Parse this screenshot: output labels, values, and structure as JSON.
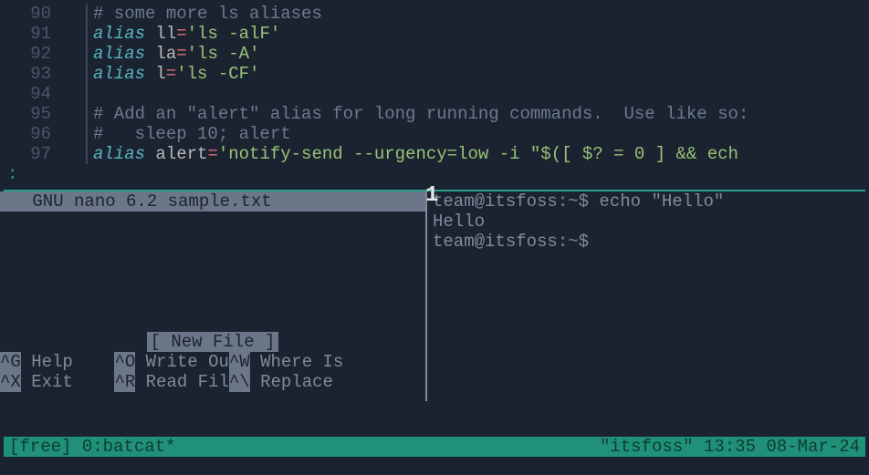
{
  "code": {
    "lines": [
      {
        "n": "90",
        "type": "comment",
        "text": "# some more ls aliases"
      },
      {
        "n": "91",
        "type": "alias",
        "name": "ll",
        "val": "'ls -alF'"
      },
      {
        "n": "92",
        "type": "alias",
        "name": "la",
        "val": "'ls -A'"
      },
      {
        "n": "93",
        "type": "alias",
        "name": "l",
        "val": "'ls -CF'"
      },
      {
        "n": "94",
        "type": "blank"
      },
      {
        "n": "95",
        "type": "comment",
        "text": "# Add an \"alert\" alias for long running commands.  Use like so:"
      },
      {
        "n": "96",
        "type": "comment",
        "text": "#   sleep 10; alert"
      },
      {
        "n": "97",
        "type": "alias",
        "name": "alert",
        "val": "'notify-send --urgency=low -i \"$([ $? = 0 ] && ech"
      }
    ],
    "prompt": ":"
  },
  "right_pane_num": "1",
  "nano": {
    "title_app": " GNU nano 6.2 ",
    "title_file": "sample.txt",
    "newfile": "[ New File ]",
    "help": [
      {
        "k": "^G",
        "l": " Help    "
      },
      {
        "k": "^O",
        "l": " Write Ou"
      },
      {
        "k": "^W",
        "l": " Where Is"
      },
      {
        "k": "^X",
        "l": " Exit    "
      },
      {
        "k": "^R",
        "l": " Read Fil"
      },
      {
        "k": "^\\",
        "l": " Replace"
      }
    ]
  },
  "term": {
    "l1": "team@itsfoss:~$ echo \"Hello\"",
    "l2": "Hello",
    "l3": "team@itsfoss:~$ "
  },
  "status": {
    "left": "[free] 0:batcat*",
    "right": "\"itsfoss\" 13:35 08-Mar-24"
  }
}
